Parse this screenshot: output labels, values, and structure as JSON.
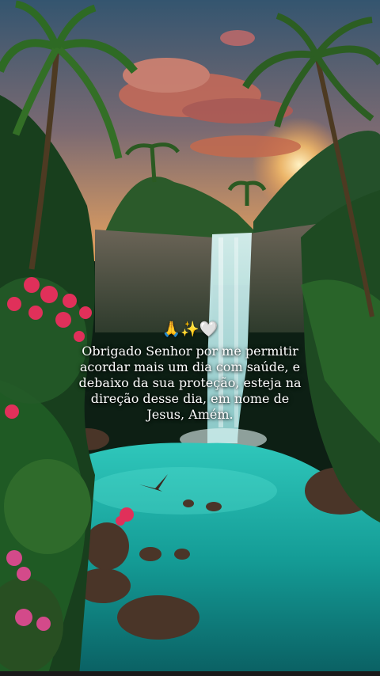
{
  "post": {
    "emojis": "🙏✨🤍",
    "message": "Obrigado Senhor por me permitir acordar mais um dia com saúde, e debaixo da sua proteção, esteja na direção desse dia, em nome de Jesus, Amém."
  },
  "palette": {
    "sky_top": "#3b5b7a",
    "sky_glow": "#f0a85a",
    "lagoon": "#1fb5a8",
    "foliage": "#1d4a22",
    "flowers": "#e0305a"
  },
  "icons": [
    "praying-hands-emoji",
    "sparkles-emoji",
    "white-heart-emoji"
  ]
}
